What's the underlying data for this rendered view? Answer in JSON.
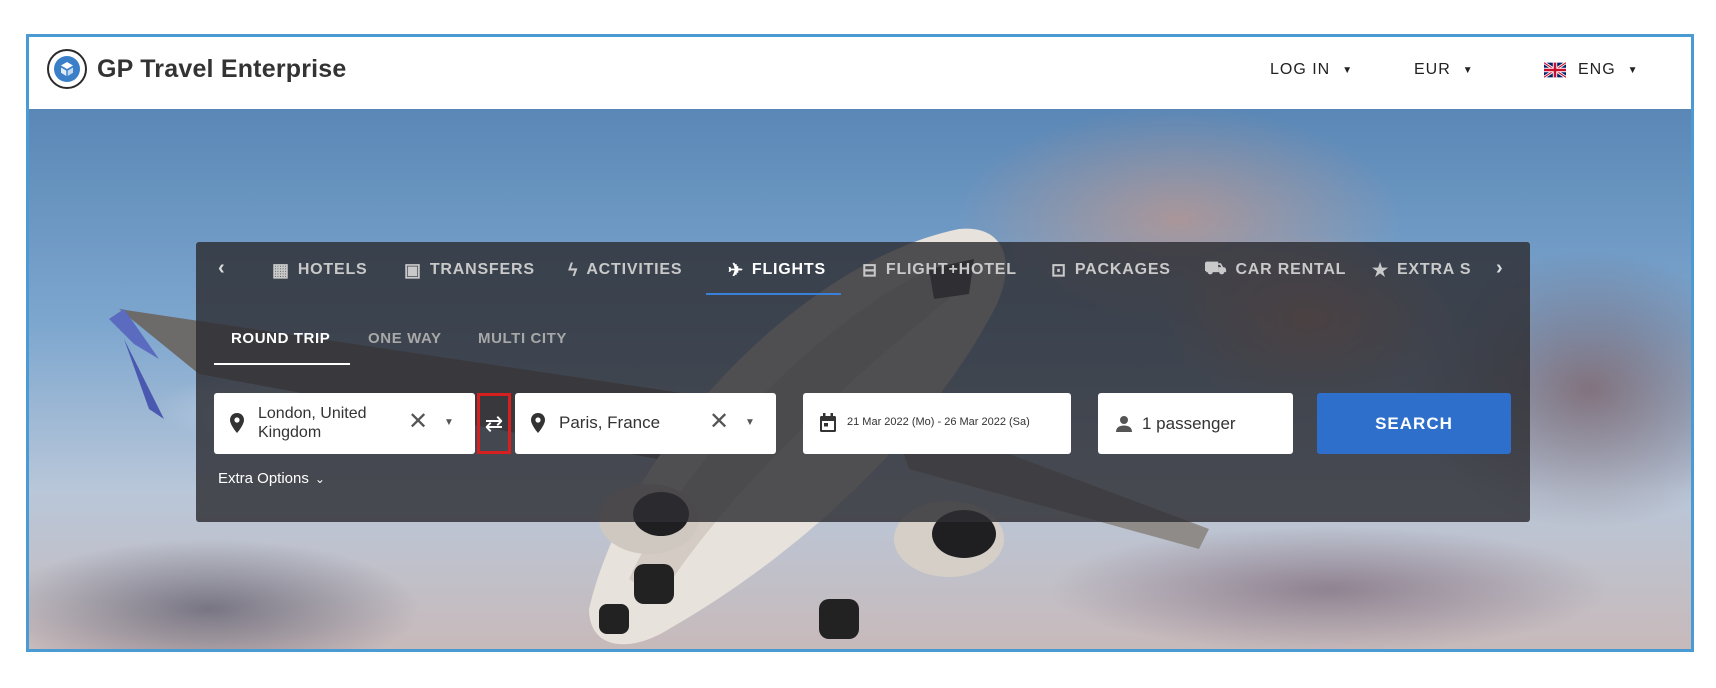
{
  "header": {
    "logo_text": "GP Travel Enterprise",
    "login_label": "LOG IN",
    "currency_label": "EUR",
    "language_label": "ENG"
  },
  "tabs": {
    "items": [
      {
        "label": "HOTELS",
        "icon": "building-icon"
      },
      {
        "label": "TRANSFERS",
        "icon": "bus-icon"
      },
      {
        "label": "ACTIVITIES",
        "icon": "bolt-icon"
      },
      {
        "label": "FLIGHTS",
        "icon": "airplane-icon",
        "active": true
      },
      {
        "label": "FLIGHT+HOTEL",
        "icon": "ticket-icon"
      },
      {
        "label": "PACKAGES",
        "icon": "briefcase-icon"
      },
      {
        "label": "CAR RENTAL",
        "icon": "car-icon"
      },
      {
        "label": "EXTRA S",
        "icon": "star-icon"
      }
    ]
  },
  "trip_types": {
    "round_trip": "ROUND TRIP",
    "one_way": "ONE WAY",
    "multi_city": "MULTI CITY",
    "selected": "ROUND TRIP"
  },
  "search": {
    "origin_line1": "London, United",
    "origin_line2": "Kingdom",
    "destination": "Paris, France",
    "dates": "21 Mar 2022 (Mo) -  26 Mar 2022 (Sa)",
    "passengers": "1 passenger",
    "search_label": "SEARCH",
    "extra_options_label": "Extra Options"
  },
  "colors": {
    "accent": "#2f6fcc",
    "frame": "#4a9ad4",
    "highlight": "#d62020"
  }
}
